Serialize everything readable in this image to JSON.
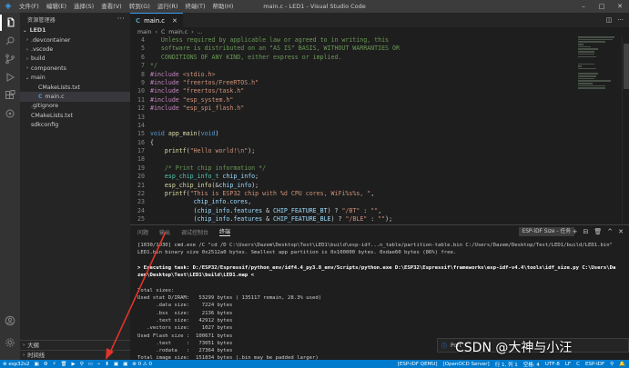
{
  "titlebar": {
    "menu": [
      "文件(F)",
      "编辑(E)",
      "选择(S)",
      "查看(V)",
      "转到(G)",
      "运行(R)",
      "终端(T)",
      "帮助(H)"
    ],
    "title": "main.c - LED1 - Visual Studio Code",
    "controls": [
      "–",
      "□",
      "✕"
    ]
  },
  "sidebar": {
    "header": "资源管理器",
    "root": "LED1",
    "items": [
      {
        "label": ".devcontainer",
        "depth": 1,
        "chevron": "›"
      },
      {
        "label": ".vscode",
        "depth": 1,
        "chevron": "›"
      },
      {
        "label": "build",
        "depth": 1,
        "chevron": "›"
      },
      {
        "label": "components",
        "depth": 1,
        "chevron": "›"
      },
      {
        "label": "main",
        "depth": 1,
        "chevron": "⌄"
      },
      {
        "label": "CMakeLists.txt",
        "depth": 2,
        "chevron": ""
      },
      {
        "label": "main.c",
        "depth": 2,
        "chevron": "",
        "selected": true,
        "c": true
      },
      {
        "label": ".gitignore",
        "depth": 1,
        "chevron": ""
      },
      {
        "label": "CMakeLists.txt",
        "depth": 1,
        "chevron": ""
      },
      {
        "label": "sdkconfig",
        "depth": 1,
        "chevron": ""
      }
    ],
    "outline": "大纲",
    "timeline": "时间线"
  },
  "editor": {
    "tab": "main.c",
    "breadcrumbs": [
      "main",
      "›",
      "C",
      "main.c",
      "›",
      "..."
    ],
    "lines": [
      {
        "n": "4",
        "html": "<span class='cm'>   Unless required by applicable law or agreed to in writing, this</span>"
      },
      {
        "n": "5",
        "html": "<span class='cm'>   software is distributed on an \"AS IS\" BASIS, WITHOUT WARRANTIES OR</span>"
      },
      {
        "n": "6",
        "html": "<span class='cm'>   CONDITIONS OF ANY KIND, either express or implied.</span>"
      },
      {
        "n": "7",
        "html": "<span class='cm'>*/</span>"
      },
      {
        "n": "8",
        "html": "<span class='pp'>#include</span> <span class='st'>&lt;stdio.h&gt;</span>"
      },
      {
        "n": "9",
        "html": "<span class='pp'>#include</span> <span class='st'>\"freertos/FreeRTOS.h\"</span>"
      },
      {
        "n": "10",
        "html": "<span class='pp'>#include</span> <span class='st'>\"freertos/task.h\"</span>"
      },
      {
        "n": "11",
        "html": "<span class='pp'>#include</span> <span class='st'>\"esp_system.h\"</span>"
      },
      {
        "n": "12",
        "html": "<span class='pp'>#include</span> <span class='st'>\"esp_spi_flash.h\"</span>"
      },
      {
        "n": "13",
        "html": ""
      },
      {
        "n": "14",
        "html": ""
      },
      {
        "n": "15",
        "html": "<span class='kw'>void</span> <span class='fn'>app_main</span>(<span class='kw'>void</span>)"
      },
      {
        "n": "16",
        "html": "{"
      },
      {
        "n": "17",
        "html": "    <span class='fn'>printf</span>(<span class='st'>\"Hello world!\\n\"</span>);"
      },
      {
        "n": "18",
        "html": ""
      },
      {
        "n": "19",
        "html": "    <span class='cm'>/* Print chip information */</span>"
      },
      {
        "n": "20",
        "html": "    <span class='ty'>esp_chip_info_t</span> <span class='va'>chip_info</span>;"
      },
      {
        "n": "21",
        "html": "    <span class='fn'>esp_chip_info</span>(&amp;<span class='va'>chip_info</span>);"
      },
      {
        "n": "22",
        "html": "    <span class='fn'>printf</span>(<span class='st'>\"This is ESP32 chip with %d CPU cores, WiFi%s%s, \"</span>,"
      },
      {
        "n": "23",
        "html": "            <span class='va'>chip_info</span>.<span class='va'>cores</span>,"
      },
      {
        "n": "24",
        "html": "            (<span class='va'>chip_info</span>.<span class='va'>features</span> &amp; <span class='va'>CHIP_FEATURE_BT</span>) ? <span class='st'>\"/BT\"</span> : <span class='st'>\"\"</span>,"
      },
      {
        "n": "25",
        "html": "            (<span class='va'>chip_info</span>.<span class='va'>features</span> &amp; <span class='va'>CHIP_FEATURE_BLE</span>) ? <span class='st'>\"/BLE\"</span> : <span class='st'>\"\"</span>);"
      }
    ]
  },
  "panel": {
    "tabs": [
      "问题",
      "输出",
      "调试控制台",
      "终端"
    ],
    "active_tab": 3,
    "terminal_select": "ESP-IDF Size - 任务",
    "term_icons": [
      "+",
      "⊟",
      "🗑",
      "^",
      "✕"
    ],
    "lines": [
      {
        "t": "[1030/1030] cmd.exe /C \"cd /D C:\\Users\\Dazem\\Desktop\\Test\\LED1\\build\\esp-idf...n_table/partition-table.bin C:/Users/Dazem/Desktop/Test/LED1/build/LED1.bin\"",
        "b": false
      },
      {
        "t": "LED1.bin binary size 0x2512a0 bytes. Smallest app partition is 0x100000 bytes. 0xdae60 bytes (86%) free.",
        "b": false
      },
      {
        "t": "",
        "b": false
      },
      {
        "t": "> Executing task: D:/ESP32/Espressif/python_env/idf4.4_py3.8_env/Scripts/python.exe D:\\ESP32\\Espressif\\frameworks\\esp-idf-v4.4\\tools\\idf_size.py C:\\Users\\Da",
        "b": true
      },
      {
        "t": "zem\\Desktop\\Test\\LED1\\build\\LED1.map <",
        "b": true
      },
      {
        "t": "",
        "b": false
      },
      {
        "t": "Total sizes:",
        "b": false
      },
      {
        "t": "Used stat D/IRAM:   53299 bytes ( 135117 remain, 28.3% used)",
        "b": false
      },
      {
        "t": "      .data size:    7224 bytes",
        "b": false
      },
      {
        "t": "      .bss  size:    2136 bytes",
        "b": false
      },
      {
        "t": "      .text size:   42912 bytes",
        "b": false
      },
      {
        "t": "   .vectors size:    1027 bytes",
        "b": false
      },
      {
        "t": "Used Flash size :  100671 bytes",
        "b": false
      },
      {
        "t": "      .text     :   73051 bytes",
        "b": false
      },
      {
        "t": "      .rodata   :   27364 bytes",
        "b": false
      },
      {
        "t": "Total image size:  151834 bytes (.bin may be padded larger)",
        "b": false
      }
    ]
  },
  "notification": "Port",
  "watermark": "CSDN @大神与小汪",
  "status": {
    "left": [
      "⊗ esp32s2",
      "▣",
      "⚙",
      "⚡",
      "🗑",
      "▶",
      "⚲",
      "▭",
      "⌁",
      "⬆",
      "▣",
      "▣",
      "⊗ 0 ⚠ 0"
    ],
    "right": [
      "[ESP-IDF QEMU]",
      "[OpenOCD Server]",
      "行 1, 列 1",
      "空格: 4",
      "UTF-8",
      "LF",
      "C",
      "ESP-IDF",
      "⚲",
      "🔔"
    ]
  },
  "colors": {
    "accent": "#007acc",
    "arrow": "#e0342a"
  }
}
